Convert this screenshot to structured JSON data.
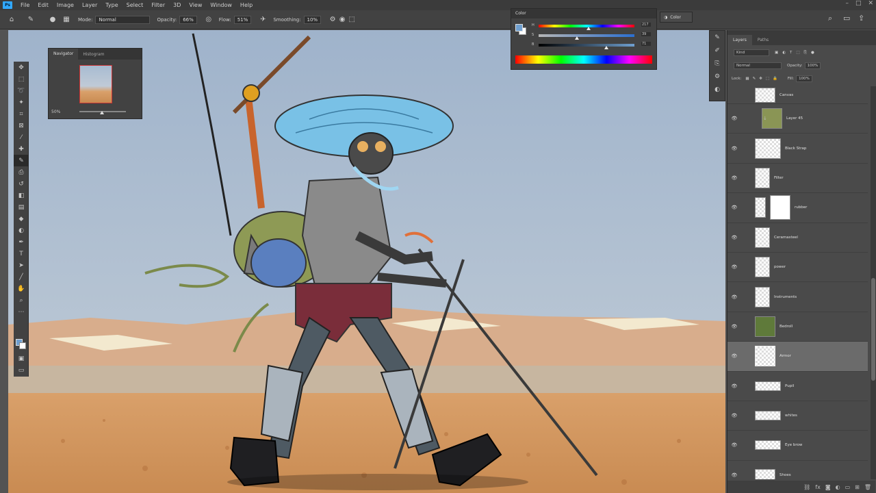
{
  "app": {
    "logo": "Ps"
  },
  "menu": [
    "File",
    "Edit",
    "Image",
    "Layer",
    "Type",
    "Select",
    "Filter",
    "3D",
    "View",
    "Window",
    "Help"
  ],
  "options": {
    "mode_label": "Mode:",
    "mode_value": "Normal",
    "opacity_label": "Opacity:",
    "opacity_value": "66%",
    "flow_label": "Flow:",
    "flow_value": "51%",
    "smoothing_label": "Smoothing:",
    "smoothing_value": "10%"
  },
  "navigator": {
    "tabs": [
      "Navigator",
      "Histogram"
    ],
    "zoom": "50%"
  },
  "color_panel": {
    "title": "Color",
    "rows": [
      {
        "label": "H",
        "value": "217"
      },
      {
        "label": "S",
        "value": "39"
      },
      {
        "label": "B",
        "value": "71"
      }
    ],
    "fg_color": "#6f9fcf",
    "bg_color": "#ffffff"
  },
  "color_tab_label": "Color",
  "layers_panel": {
    "tabs": [
      "Layers",
      "Paths"
    ],
    "filter_label": "Kind",
    "blend_mode": "Normal",
    "opacity_label": "Opacity:",
    "opacity_value": "100%",
    "lock_label": "Lock:",
    "fill_label": "Fill:",
    "fill_value": "100%",
    "layers": [
      {
        "name": "Canvas"
      },
      {
        "name": "Layer 45"
      },
      {
        "name": "Black Strap"
      },
      {
        "name": "Filter"
      },
      {
        "name": "rubber"
      },
      {
        "name": "Ceramasteel"
      },
      {
        "name": "power"
      },
      {
        "name": "Instruments"
      },
      {
        "name": "Bedroll"
      },
      {
        "name": "Armor"
      },
      {
        "name": "Pupil"
      },
      {
        "name": "whites"
      },
      {
        "name": "Eye brow"
      },
      {
        "name": "Shoes"
      }
    ]
  }
}
